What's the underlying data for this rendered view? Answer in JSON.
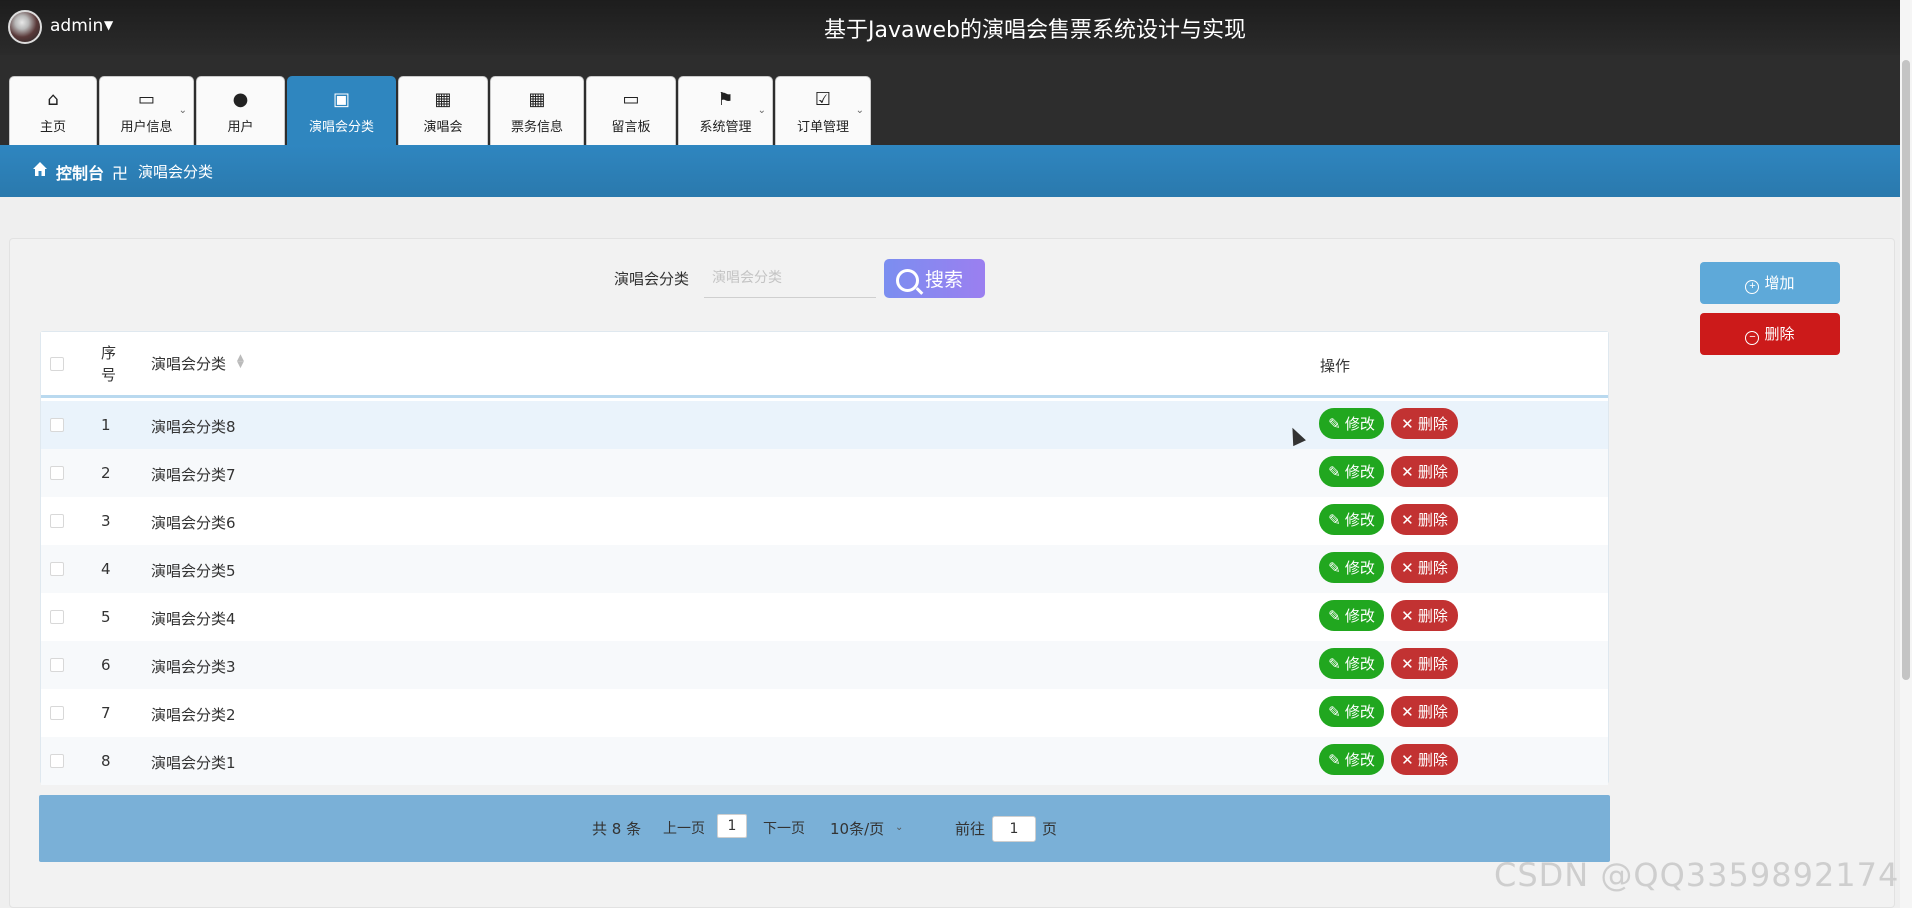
{
  "header": {
    "username": "admin",
    "title": "基于Javaweb的演唱会售票系统设计与实现"
  },
  "nav": {
    "tabs": [
      {
        "label": "主页",
        "icon": "home-icon",
        "active": false,
        "dropdown": false
      },
      {
        "label": "用户信息",
        "icon": "wallet-icon",
        "active": false,
        "dropdown": true
      },
      {
        "label": "用户",
        "icon": "location-pin-icon",
        "active": false,
        "dropdown": false
      },
      {
        "label": "演唱会分类",
        "icon": "clipboard-x-icon",
        "active": true,
        "dropdown": false
      },
      {
        "label": "演唱会",
        "icon": "grid-icon",
        "active": false,
        "dropdown": false
      },
      {
        "label": "票务信息",
        "icon": "grid-icon",
        "active": false,
        "dropdown": false
      },
      {
        "label": "留言板",
        "icon": "wallet-icon",
        "active": false,
        "dropdown": false
      },
      {
        "label": "系统管理",
        "icon": "flag-icon",
        "active": false,
        "dropdown": true
      },
      {
        "label": "订单管理",
        "icon": "clipboard-check-icon",
        "active": false,
        "dropdown": true
      }
    ]
  },
  "breadcrumb": {
    "home": "控制台",
    "separator": "卍",
    "current": "演唱会分类"
  },
  "search": {
    "label": "演唱会分类",
    "placeholder": "演唱会分类",
    "value": "",
    "button": "搜索"
  },
  "actions": {
    "add": "增加",
    "delete": "删除"
  },
  "table": {
    "headers": {
      "seq": "序号",
      "name": "演唱会分类",
      "ops": "操作"
    },
    "edit_label": "修改",
    "delete_label": "删除",
    "rows": [
      {
        "seq": "1",
        "name": "演唱会分类8"
      },
      {
        "seq": "2",
        "name": "演唱会分类7"
      },
      {
        "seq": "3",
        "name": "演唱会分类6"
      },
      {
        "seq": "4",
        "name": "演唱会分类5"
      },
      {
        "seq": "5",
        "name": "演唱会分类4"
      },
      {
        "seq": "6",
        "name": "演唱会分类3"
      },
      {
        "seq": "7",
        "name": "演唱会分类2"
      },
      {
        "seq": "8",
        "name": "演唱会分类1"
      }
    ]
  },
  "pagination": {
    "total": "共 8 条",
    "prev": "上一页",
    "page": "1",
    "next": "下一页",
    "size": "10条/页",
    "goto": "前往",
    "goto_value": "1",
    "page_unit": "页"
  },
  "watermark": "CSDN @QQ3359892174",
  "colors": {
    "accent_blue": "#2f86bf",
    "edit_green": "#21a71f",
    "delete_red": "#cc1a1a",
    "search_gradient": "#7b8ef0"
  }
}
